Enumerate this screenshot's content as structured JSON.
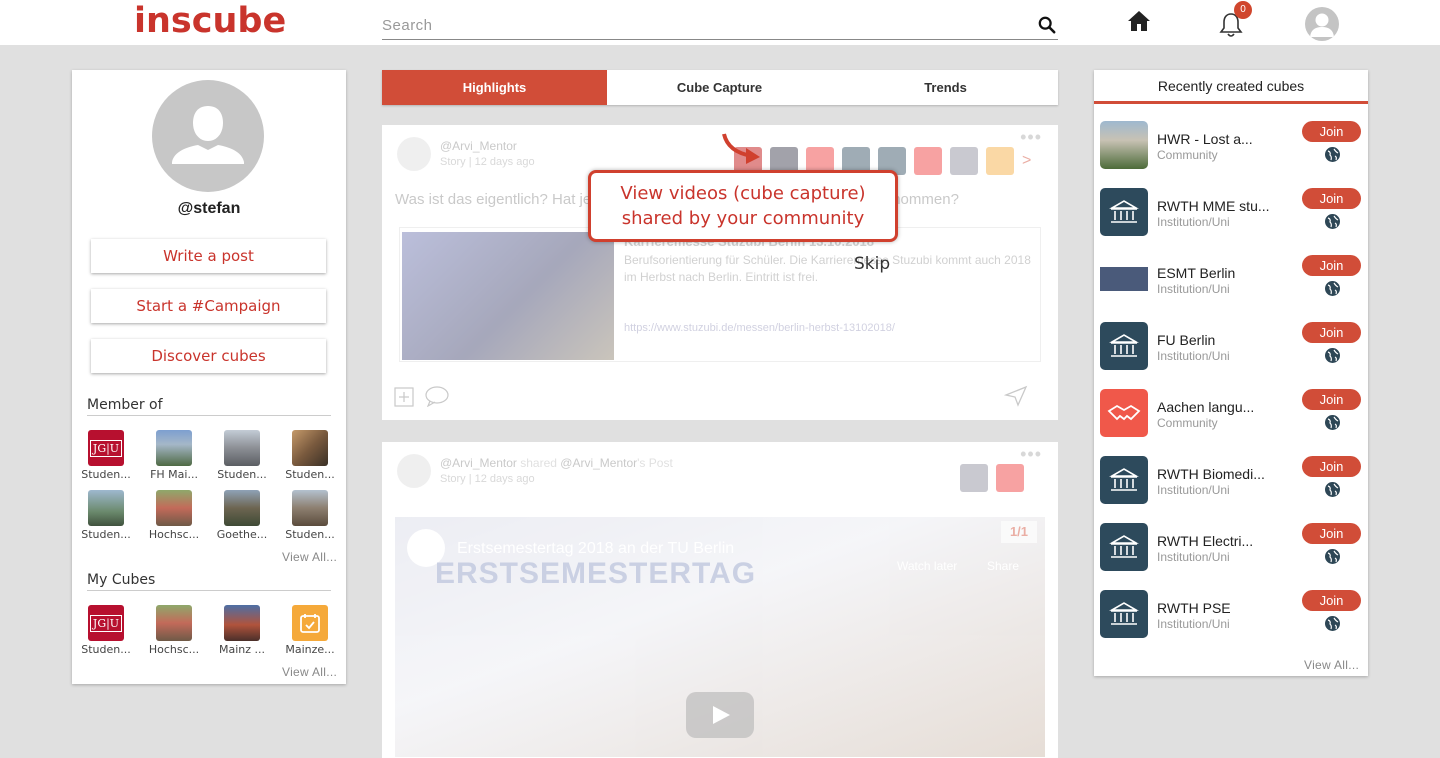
{
  "header": {
    "logo": "inscube",
    "search_placeholder": "Search",
    "notification_count": "0"
  },
  "profile": {
    "username": "@stefan",
    "buttons": [
      "Write a post",
      "Start a #Campaign",
      "Discover cubes"
    ],
    "member_of_title": "Member of",
    "member_of": [
      {
        "label": "Studen...",
        "icon": "jgu-logo"
      },
      {
        "label": "FH Mai...",
        "icon": "building-photo"
      },
      {
        "label": "Studen...",
        "icon": "building-photo"
      },
      {
        "label": "Studen...",
        "icon": "building-photo"
      },
      {
        "label": "Studen...",
        "icon": "building-photo"
      },
      {
        "label": "Hochsc...",
        "icon": "building-photo"
      },
      {
        "label": "Goethe...",
        "icon": "building-photo"
      },
      {
        "label": "Studen...",
        "icon": "building-photo"
      }
    ],
    "member_view_all": "View All...",
    "my_cubes_title": "My Cubes",
    "my_cubes": [
      {
        "label": "Studen...",
        "icon": "jgu-logo"
      },
      {
        "label": "Hochsc...",
        "icon": "building-photo"
      },
      {
        "label": "Mainz ...",
        "icon": "building-photo"
      },
      {
        "label": "Mainze...",
        "icon": "calendar-icon"
      }
    ],
    "my_cubes_view_all": "View All..."
  },
  "tabs": [
    "Highlights",
    "Cube Capture",
    "Trends"
  ],
  "feed": {
    "post1": {
      "author": "@Arvi_Mentor",
      "meta": "Story  |  12 days ago",
      "text": "Was ist das eigentlich? Hat jemand letztes Jahr an der Veranstaltung teilgenommen?",
      "link_title": "Karrieremesse Stuzubi Berlin 13.10.2018",
      "link_desc": "Berufsorientierung für Schüler. Die Karrieremesse Stuzubi kommt auch 2018 im Herbst nach Berlin. Eintritt ist frei.",
      "link_url": "https://www.stuzubi.de/messen/berlin-herbst-13102018/"
    },
    "post2": {
      "author": "@Arvi_Mentor",
      "shared": "shared",
      "shared_author": "@Arvi_Mentor",
      "shared_suffix": "'s Post",
      "meta": "Story  |  12 days ago",
      "video_title": "Erstsemestertag 2018 an der TU Berlin",
      "video_big": "ERSTSEMESTERTAG",
      "watch_later": "Watch later",
      "share": "Share",
      "counter": "1/1"
    }
  },
  "tooltip": {
    "line1": "View videos (cube capture)",
    "line2": "shared by your community",
    "skip": "Skip"
  },
  "recent": {
    "title": "Recently created cubes",
    "join_label": "Join",
    "items": [
      {
        "name": "HWR - Lost a...",
        "type": "Community",
        "icon": "building-photo"
      },
      {
        "name": "RWTH MME stu...",
        "type": "Institution/Uni",
        "icon": "institution-icon"
      },
      {
        "name": "ESMT Berlin",
        "type": "Institution/Uni",
        "icon": "esmt-logo"
      },
      {
        "name": "FU Berlin",
        "type": "Institution/Uni",
        "icon": "institution-icon"
      },
      {
        "name": "Aachen langu...",
        "type": "Community",
        "icon": "handshake-icon"
      },
      {
        "name": "RWTH Biomedi...",
        "type": "Institution/Uni",
        "icon": "institution-icon"
      },
      {
        "name": "RWTH Electri...",
        "type": "Institution/Uni",
        "icon": "institution-icon"
      },
      {
        "name": "RWTH PSE",
        "type": "Institution/Uni",
        "icon": "institution-icon"
      }
    ],
    "view_all": "View All..."
  },
  "colors": {
    "accent": "#d14d38",
    "brand": "#c9342c"
  }
}
